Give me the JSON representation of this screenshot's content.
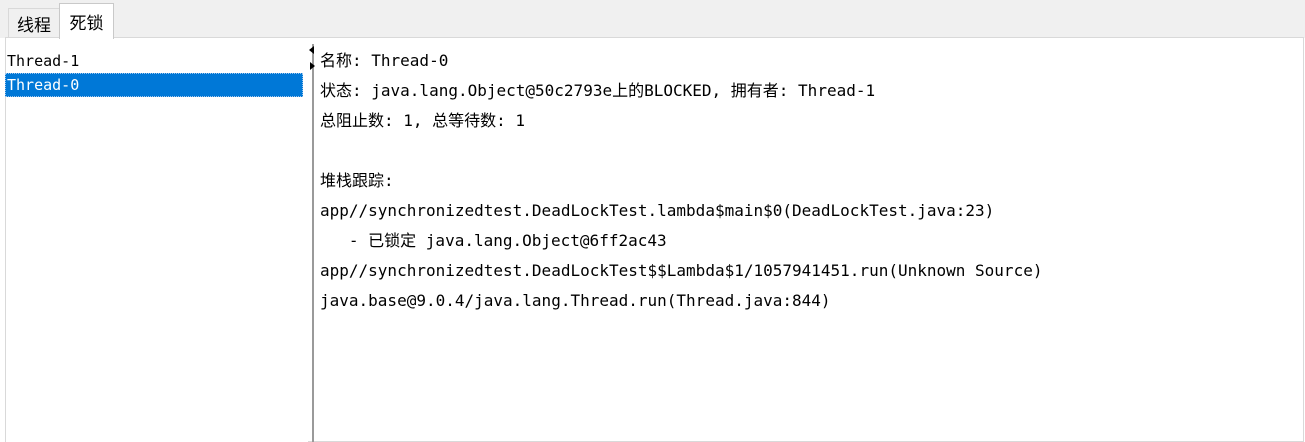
{
  "tabs": [
    {
      "label": "线程",
      "active": false
    },
    {
      "label": "死锁",
      "active": true
    }
  ],
  "threads": [
    {
      "name": "Thread-1",
      "selected": false
    },
    {
      "name": "Thread-0",
      "selected": true
    }
  ],
  "detail": {
    "lines": [
      "名称: Thread-0",
      "状态: java.lang.Object@50c2793e上的BLOCKED, 拥有者: Thread-1",
      "总阻止数: 1, 总等待数: 1",
      "",
      "堆栈跟踪:",
      "app//synchronizedtest.DeadLockTest.lambda$main$0(DeadLockTest.java:23)",
      "   - 已锁定 java.lang.Object@6ff2ac43",
      "app//synchronizedtest.DeadLockTest$$Lambda$1/1057941451.run(Unknown Source)",
      "java.base@9.0.4/java.lang.Thread.run(Thread.java:844)"
    ]
  },
  "colors": {
    "selection": "#0078d7",
    "tabbar": "#f0f0f0"
  }
}
